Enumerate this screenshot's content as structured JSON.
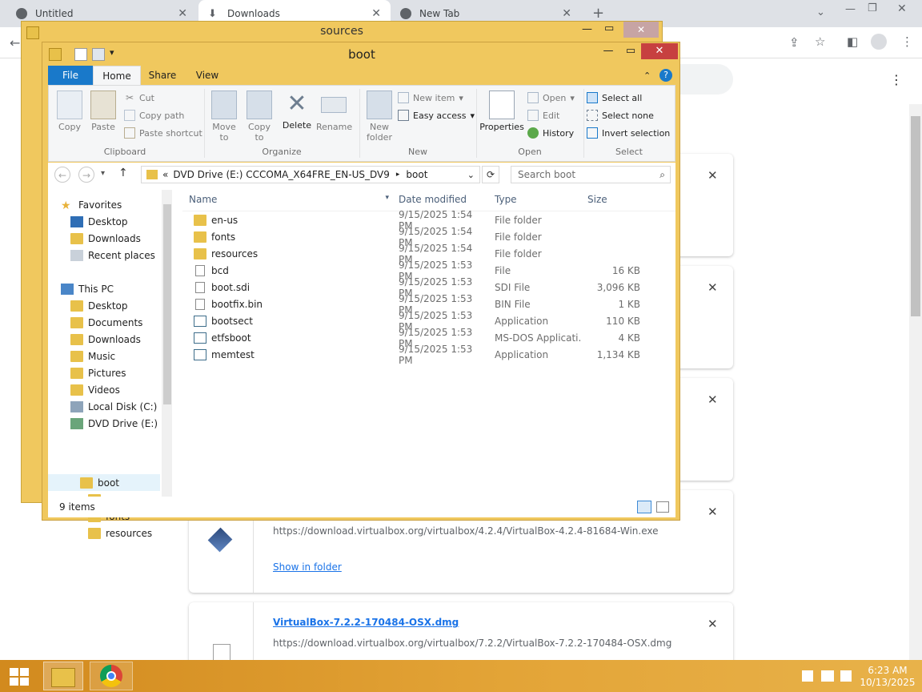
{
  "chrome": {
    "tabs": [
      {
        "title": "Untitled",
        "close": "✕"
      },
      {
        "title": "Downloads",
        "close": "✕"
      },
      {
        "title": "New Tab",
        "close": "✕"
      }
    ],
    "new_tab": "+",
    "window_controls": {
      "minimize": "—",
      "restore": "❐",
      "close": "✕"
    }
  },
  "downloads_page": {
    "items": [
      {
        "url": "https://download.virtualbox.org/virtualbox/4.2.4/VirtualBox-4.2.4-81684-Win.exe",
        "action": "Show in folder"
      },
      {
        "name": "VirtualBox-7.2.2-170484-OSX.dmg",
        "url": "https://download.virtualbox.org/virtualbox/7.2.2/VirtualBox-7.2.2-170484-OSX.dmg"
      }
    ]
  },
  "sources_window": {
    "title": "sources"
  },
  "explorer": {
    "title": "boot",
    "ribbon_tabs": [
      "File",
      "Home",
      "Share",
      "View"
    ],
    "clipboard": {
      "copy": "Copy",
      "paste": "Paste",
      "cut": "Cut",
      "copy_path": "Copy path",
      "paste_shortcut": "Paste shortcut",
      "group": "Clipboard"
    },
    "organize": {
      "move_to": "Move to",
      "copy_to": "Copy to",
      "delete": "Delete",
      "rename": "Rename",
      "group": "Organize"
    },
    "new": {
      "new_folder": "New folder",
      "new_item": "New item",
      "easy_access": "Easy access",
      "group": "New"
    },
    "open": {
      "properties": "Properties",
      "open": "Open",
      "edit": "Edit",
      "history": "History",
      "group": "Open"
    },
    "select": {
      "select_all": "Select all",
      "select_none": "Select none",
      "invert": "Invert selection",
      "group": "Select"
    },
    "address": {
      "prefix": "«",
      "drive": "DVD Drive (E:) CCCOMA_X64FRE_EN-US_DV9",
      "folder": "boot"
    },
    "search_placeholder": "Search boot",
    "nav": {
      "favorites": "Favorites",
      "fav_items": [
        "Desktop",
        "Downloads",
        "Recent places"
      ],
      "this_pc": "This PC",
      "pc_items": [
        "Desktop",
        "Documents",
        "Downloads",
        "Music",
        "Pictures",
        "Videos",
        "Local Disk (C:)",
        "DVD Drive (E:) CC"
      ],
      "boot": "boot",
      "boot_children": [
        "en-us",
        "fonts",
        "resources"
      ]
    },
    "columns": {
      "name": "Name",
      "date": "Date modified",
      "type": "Type",
      "size": "Size"
    },
    "files": [
      {
        "name": "en-us",
        "date": "9/15/2025 1:54 PM",
        "type": "File folder",
        "size": "",
        "kind": "folder"
      },
      {
        "name": "fonts",
        "date": "9/15/2025 1:54 PM",
        "type": "File folder",
        "size": "",
        "kind": "folder"
      },
      {
        "name": "resources",
        "date": "9/15/2025 1:54 PM",
        "type": "File folder",
        "size": "",
        "kind": "folder"
      },
      {
        "name": "bcd",
        "date": "9/15/2025 1:53 PM",
        "type": "File",
        "size": "16 KB",
        "kind": "file"
      },
      {
        "name": "boot.sdi",
        "date": "9/15/2025 1:53 PM",
        "type": "SDI File",
        "size": "3,096 KB",
        "kind": "file"
      },
      {
        "name": "bootfix.bin",
        "date": "9/15/2025 1:53 PM",
        "type": "BIN File",
        "size": "1 KB",
        "kind": "file"
      },
      {
        "name": "bootsect",
        "date": "9/15/2025 1:53 PM",
        "type": "Application",
        "size": "110 KB",
        "kind": "app"
      },
      {
        "name": "etfsboot",
        "date": "9/15/2025 1:53 PM",
        "type": "MS-DOS Applicati...",
        "size": "4 KB",
        "kind": "app"
      },
      {
        "name": "memtest",
        "date": "9/15/2025 1:53 PM",
        "type": "Application",
        "size": "1,134 KB",
        "kind": "app"
      }
    ],
    "status": "9 items"
  },
  "taskbar": {
    "time": "6:23 AM",
    "date": "10/13/2025"
  }
}
